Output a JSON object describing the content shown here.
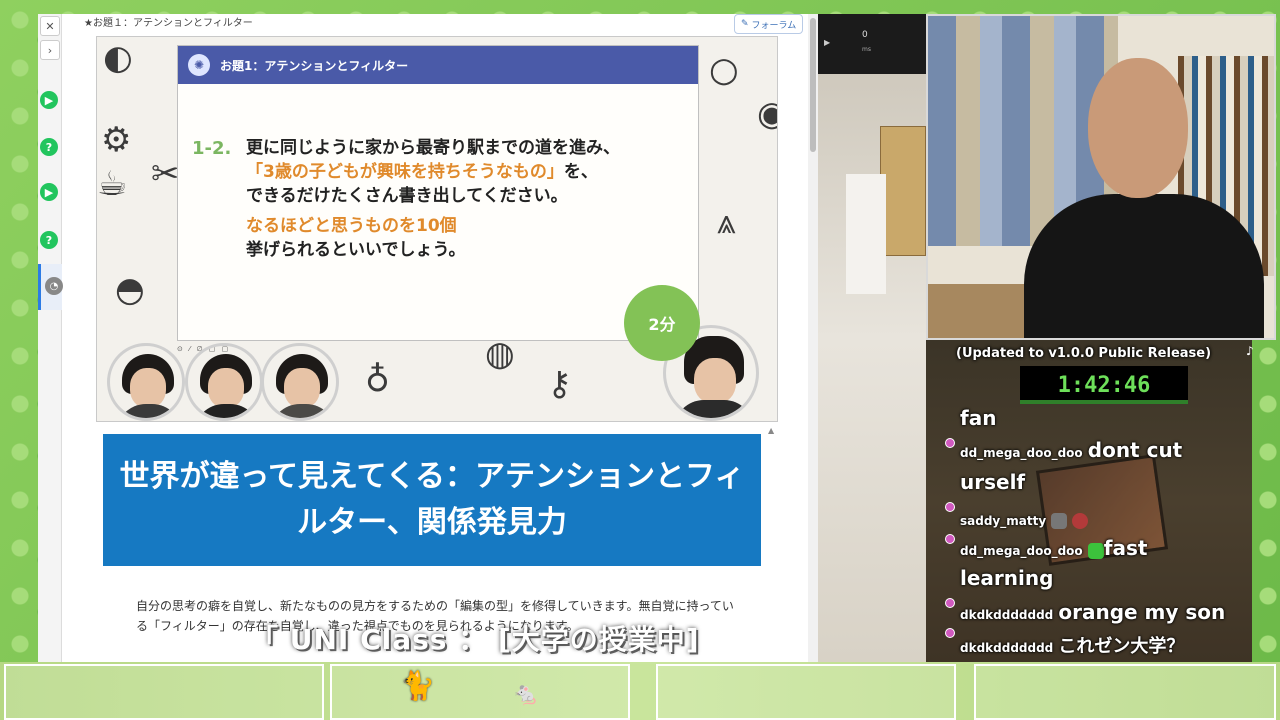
{
  "browser": {
    "page_title": "★お題１：アテンションとフィルター",
    "form_button": "フォーラム",
    "rail": {
      "close": "✕",
      "next": "›",
      "play": "▶",
      "question": "?"
    }
  },
  "slide": {
    "header": "お題1：アテンションとフィルター",
    "number": "1-2.",
    "line1": "更に同じように家から最寄り駅までの道を進み、",
    "line2_orange": "「3歳の子どもが興味を持ちそうなもの」",
    "line2_rest": "を、",
    "line3": "できるだけたくさん書き出してください。",
    "sub_orange": "なるほどと思うものを10個",
    "sub_rest": "挙げられるといいでしょう。",
    "timer": "2分",
    "pen_tools": "⊙ ⁄ ∅ ▢ ▢"
  },
  "banner": {
    "text": "世界が違って見えてくる：アテンションとフィルター、関係発見力"
  },
  "description": {
    "text": "自分の思考の癖を自覚し、新たなものの見方をするための「編集の型」を修得していきます。無自覚に持っている「フィルター」の存在を自覚し、違った視点でものを見られるようになります。"
  },
  "mid": {
    "count": "0",
    "unit": "ms"
  },
  "stream": {
    "updated": "(Updated to v1.0.0 Public Release)",
    "timer": "1:42:46",
    "chat": [
      {
        "user": "",
        "message": "fan"
      },
      {
        "user": "dd_mega_doo_doo",
        "message": "dont cut"
      },
      {
        "user": "",
        "message": "urself"
      },
      {
        "user": "saddy_matty",
        "message": ""
      },
      {
        "user": "dd_mega_doo_doo",
        "message": "fast"
      },
      {
        "user": "",
        "message": "learning"
      },
      {
        "user": "dkdkddddddd",
        "message": "orange my son"
      },
      {
        "user": "dkdkddddddd",
        "message": "これゼン大学？"
      }
    ]
  },
  "caption": {
    "text": "「 UNI Class  ：  [大学の授業中]"
  },
  "colors": {
    "slide_header": "#4a5aa8",
    "accent_green": "#83c256",
    "accent_orange": "#e08a2c",
    "banner_blue": "#1679c2",
    "timer_green": "#6ee05a"
  }
}
